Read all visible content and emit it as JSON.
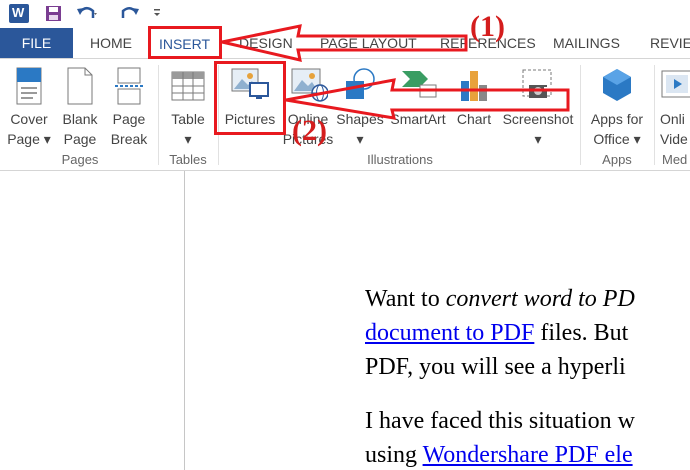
{
  "toolbar": {
    "app_logo": "W",
    "icons": [
      "word-logo-icon",
      "save-icon",
      "undo-icon",
      "redo-icon",
      "customize-icon"
    ]
  },
  "tabs": [
    {
      "label": "FILE"
    },
    {
      "label": "HOME"
    },
    {
      "label": "INSERT"
    },
    {
      "label": "DESIGN"
    },
    {
      "label": "PAGE LAYOUT"
    },
    {
      "label": "REFERENCES"
    },
    {
      "label": "MAILINGS"
    },
    {
      "label": "REVIEW"
    }
  ],
  "ribbon": {
    "pages": {
      "group_label": "Pages",
      "cover": {
        "line1": "Cover",
        "line2": "Page ▾"
      },
      "blank": {
        "line1": "Blank",
        "line2": "Page"
      },
      "break": {
        "line1": "Page",
        "line2": "Break"
      }
    },
    "tables": {
      "group_label": "Tables",
      "table": {
        "line1": "Table",
        "line2": "▾"
      }
    },
    "illustrations": {
      "group_label": "Illustrations",
      "pictures": "Pictures",
      "online": {
        "line1": "Online",
        "line2": "Pictures"
      },
      "shapes": {
        "line1": "Shapes",
        "line2": "▾"
      },
      "smartart": "SmartArt",
      "chart": "Chart",
      "screenshot": {
        "line1": "Screenshot",
        "line2": "▾"
      }
    },
    "apps": {
      "group_label": "Apps",
      "apps_office": {
        "line1": "Apps for",
        "line2": "Office ▾"
      }
    },
    "media": {
      "group_label": "Med",
      "online_video": {
        "line1": "Onli",
        "line2": "Vide"
      }
    }
  },
  "document": {
    "line1_a": "Want to ",
    "line1_b": "convert word to PD",
    "line2_link": "document to PDF",
    "line2_rest": " files. But",
    "line3": "PDF, you will see a hyperli",
    "line4": "I have faced this situation w",
    "line5_a": "using ",
    "line5_link": "Wondershare PDF ele"
  },
  "annotations": {
    "step1": "(1)",
    "step2": "(2)",
    "color": "#e8191f"
  },
  "colors": {
    "accent": "#2b579a",
    "link": "#0000ee"
  }
}
